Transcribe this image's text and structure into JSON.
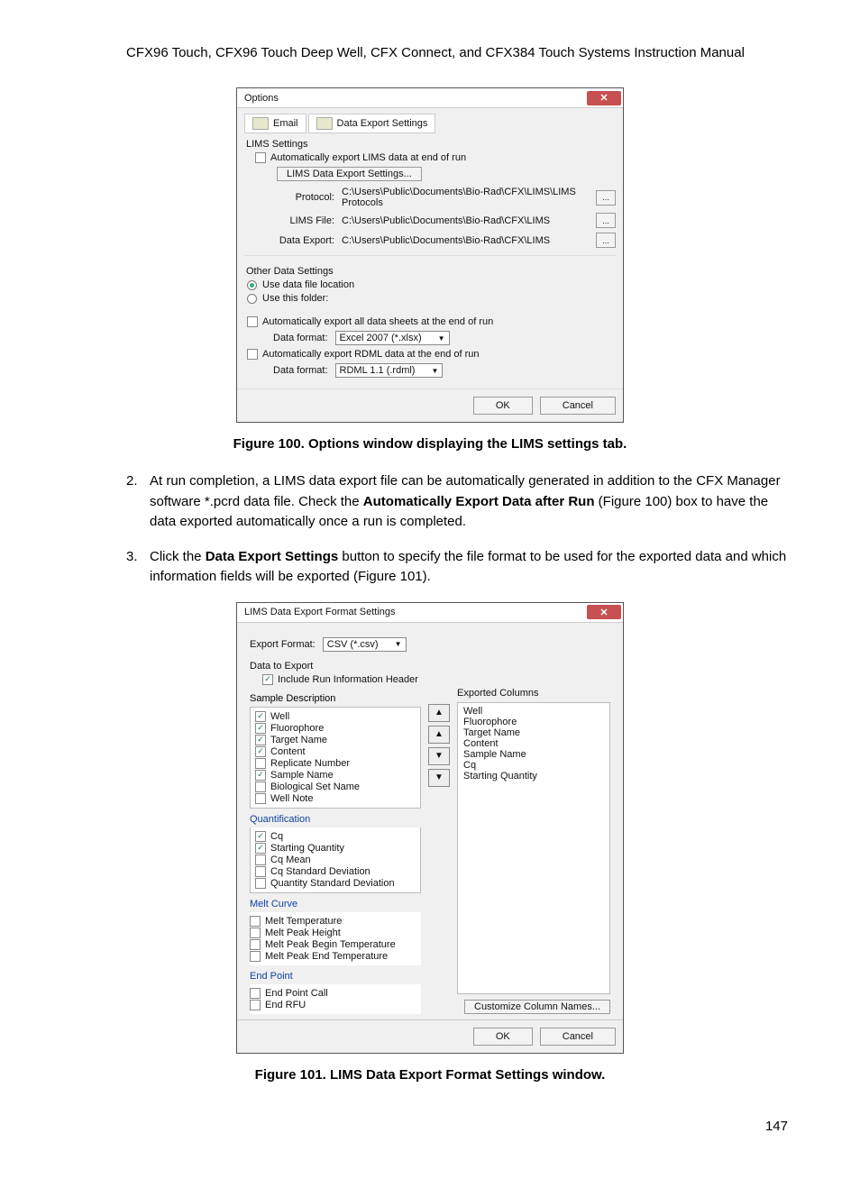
{
  "header": {
    "title": "CFX96 Touch, CFX96 Touch Deep Well, CFX Connect, and CFX384 Touch Systems Instruction Manual"
  },
  "dialog1": {
    "title": "Options",
    "close": "✕",
    "tab_email": "Email",
    "tab_data_export": "Data Export Settings",
    "lims_section": "LIMS Settings",
    "auto_export_lims": "Automatically export LIMS data at end of run",
    "lims_btn": "LIMS Data Export Settings...",
    "protocol_lbl": "Protocol:",
    "protocol_val": "C:\\Users\\Public\\Documents\\Bio-Rad\\CFX\\LIMS\\LIMS Protocols",
    "limsfile_lbl": "LIMS File:",
    "limsfile_val": "C:\\Users\\Public\\Documents\\Bio-Rad\\CFX\\LIMS",
    "dataexp_lbl": "Data Export:",
    "dataexp_val": "C:\\Users\\Public\\Documents\\Bio-Rad\\CFX\\LIMS",
    "browse": "...",
    "other_section": "Other Data Settings",
    "use_location": "Use data file location",
    "use_folder": "Use this folder:",
    "auto_all": "Automatically export all data sheets at the end of run",
    "data_format_lbl": "Data format:",
    "data_format_val": "Excel 2007 (*.xlsx)",
    "auto_rdml": "Automatically export RDML data at the end of run",
    "rdml_lbl": "Data format:",
    "rdml_val": "RDML 1.1 (.rdml)",
    "ok": "OK",
    "cancel": "Cancel"
  },
  "caption1": "Figure 100. Options window displaying the LIMS settings tab.",
  "step2": {
    "num": "2.",
    "t1": "At run completion, a LIMS data export file can be automatically generated in addition to the CFX Manager software *.pcrd data file. Check the ",
    "b1": "Automatically Export Data after Run",
    "t2": " (Figure 100) box to have the data exported automatically once a run is completed."
  },
  "step3": {
    "num": "3.",
    "t1": "Click the ",
    "b1": "Data Export Settings",
    "t2": " button to specify the file format to be used for the exported data and which information fields will be exported (Figure 101)."
  },
  "dialog2": {
    "title": "LIMS Data Export Format Settings",
    "close": "✕",
    "export_format_lbl": "Export Format:",
    "export_format_val": "CSV (*.csv)",
    "data_to_export": "Data to Export",
    "include_header": "Include Run Information Header",
    "sample_desc": "Sample Description",
    "exported_cols": "Exported Columns",
    "items_sample": [
      {
        "label": "Well",
        "checked": true
      },
      {
        "label": "Fluorophore",
        "checked": true
      },
      {
        "label": "Target Name",
        "checked": true
      },
      {
        "label": "Content",
        "checked": true
      },
      {
        "label": "Replicate Number",
        "checked": false
      },
      {
        "label": "Sample Name",
        "checked": true
      },
      {
        "label": "Biological Set Name",
        "checked": false
      },
      {
        "label": "Well Note",
        "checked": false
      }
    ],
    "quant": "Quantification",
    "items_quant": [
      {
        "label": "Cq",
        "checked": true
      },
      {
        "label": "Starting Quantity",
        "checked": true
      },
      {
        "label": "Cq Mean",
        "checked": false
      },
      {
        "label": "Cq Standard Deviation",
        "checked": false
      },
      {
        "label": "Quantity Standard Deviation",
        "checked": false
      }
    ],
    "melt": "Melt Curve",
    "items_melt": [
      {
        "label": "Melt Temperature",
        "checked": false
      },
      {
        "label": "Melt Peak Height",
        "checked": false
      },
      {
        "label": "Melt Peak Begin Temperature",
        "checked": false
      },
      {
        "label": "Melt Peak End Temperature",
        "checked": false
      }
    ],
    "endpoint": "End Point",
    "items_endpoint": [
      {
        "label": "End Point Call",
        "checked": false
      },
      {
        "label": "End RFU",
        "checked": false
      }
    ],
    "exported_list": [
      "Well",
      "Fluorophore",
      "Target Name",
      "Content",
      "Sample Name",
      "Cq",
      "Starting Quantity"
    ],
    "customize": "Customize Column Names...",
    "ok": "OK",
    "cancel": "Cancel"
  },
  "caption2": "Figure 101. LIMS Data Export Format Settings window.",
  "page_num": "147"
}
